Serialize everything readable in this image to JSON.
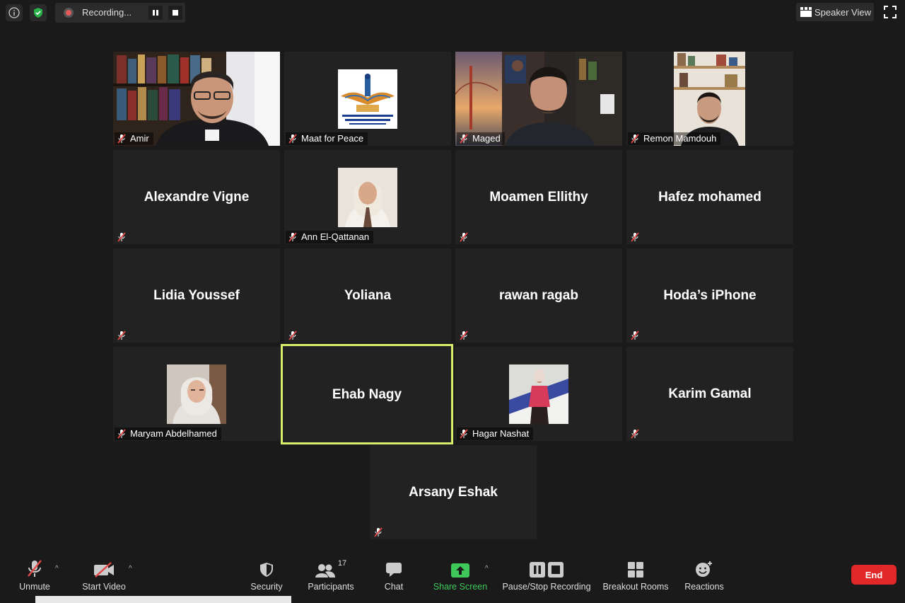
{
  "topbar": {
    "recording_label": "Recording...",
    "speaker_view_label": "Speaker View"
  },
  "participants": [
    {
      "name": "Amir",
      "type": "video"
    },
    {
      "name": "Maat for  Peace",
      "type": "logo"
    },
    {
      "name": "Maged",
      "type": "video"
    },
    {
      "name": "Remon Mamdouh",
      "type": "video"
    },
    {
      "name": "Alexandre Vigne",
      "type": "text"
    },
    {
      "name": "Ann El-Qattanan",
      "type": "photo"
    },
    {
      "name": "Moamen Ellithy",
      "type": "text"
    },
    {
      "name": "Hafez mohamed",
      "type": "text"
    },
    {
      "name": "Lidia Youssef",
      "type": "text"
    },
    {
      "name": "Yoliana",
      "type": "text"
    },
    {
      "name": "rawan ragab",
      "type": "text"
    },
    {
      "name": "Hoda’s iPhone",
      "type": "text"
    },
    {
      "name": "Maryam Abdelhamed",
      "type": "photo"
    },
    {
      "name": "Ehab Nagy",
      "type": "text",
      "active": true
    },
    {
      "name": "Hagar Nashat",
      "type": "photo"
    },
    {
      "name": "Karim Gamal",
      "type": "text"
    },
    {
      "name": "Arsany Eshak",
      "type": "text"
    }
  ],
  "toolbar": {
    "unmute": "Unmute",
    "start_video": "Start Video",
    "security": "Security",
    "participants": "Participants",
    "participants_count": "17",
    "chat": "Chat",
    "share_screen": "Share Screen",
    "pause_stop_recording": "Pause/Stop Recording",
    "breakout_rooms": "Breakout Rooms",
    "reactions": "Reactions",
    "end": "End"
  },
  "colors": {
    "active_speaker_border": "#d6ee6a",
    "end_button": "#e02828",
    "share_screen": "#3ec85a",
    "mute_slash": "#e04848"
  }
}
